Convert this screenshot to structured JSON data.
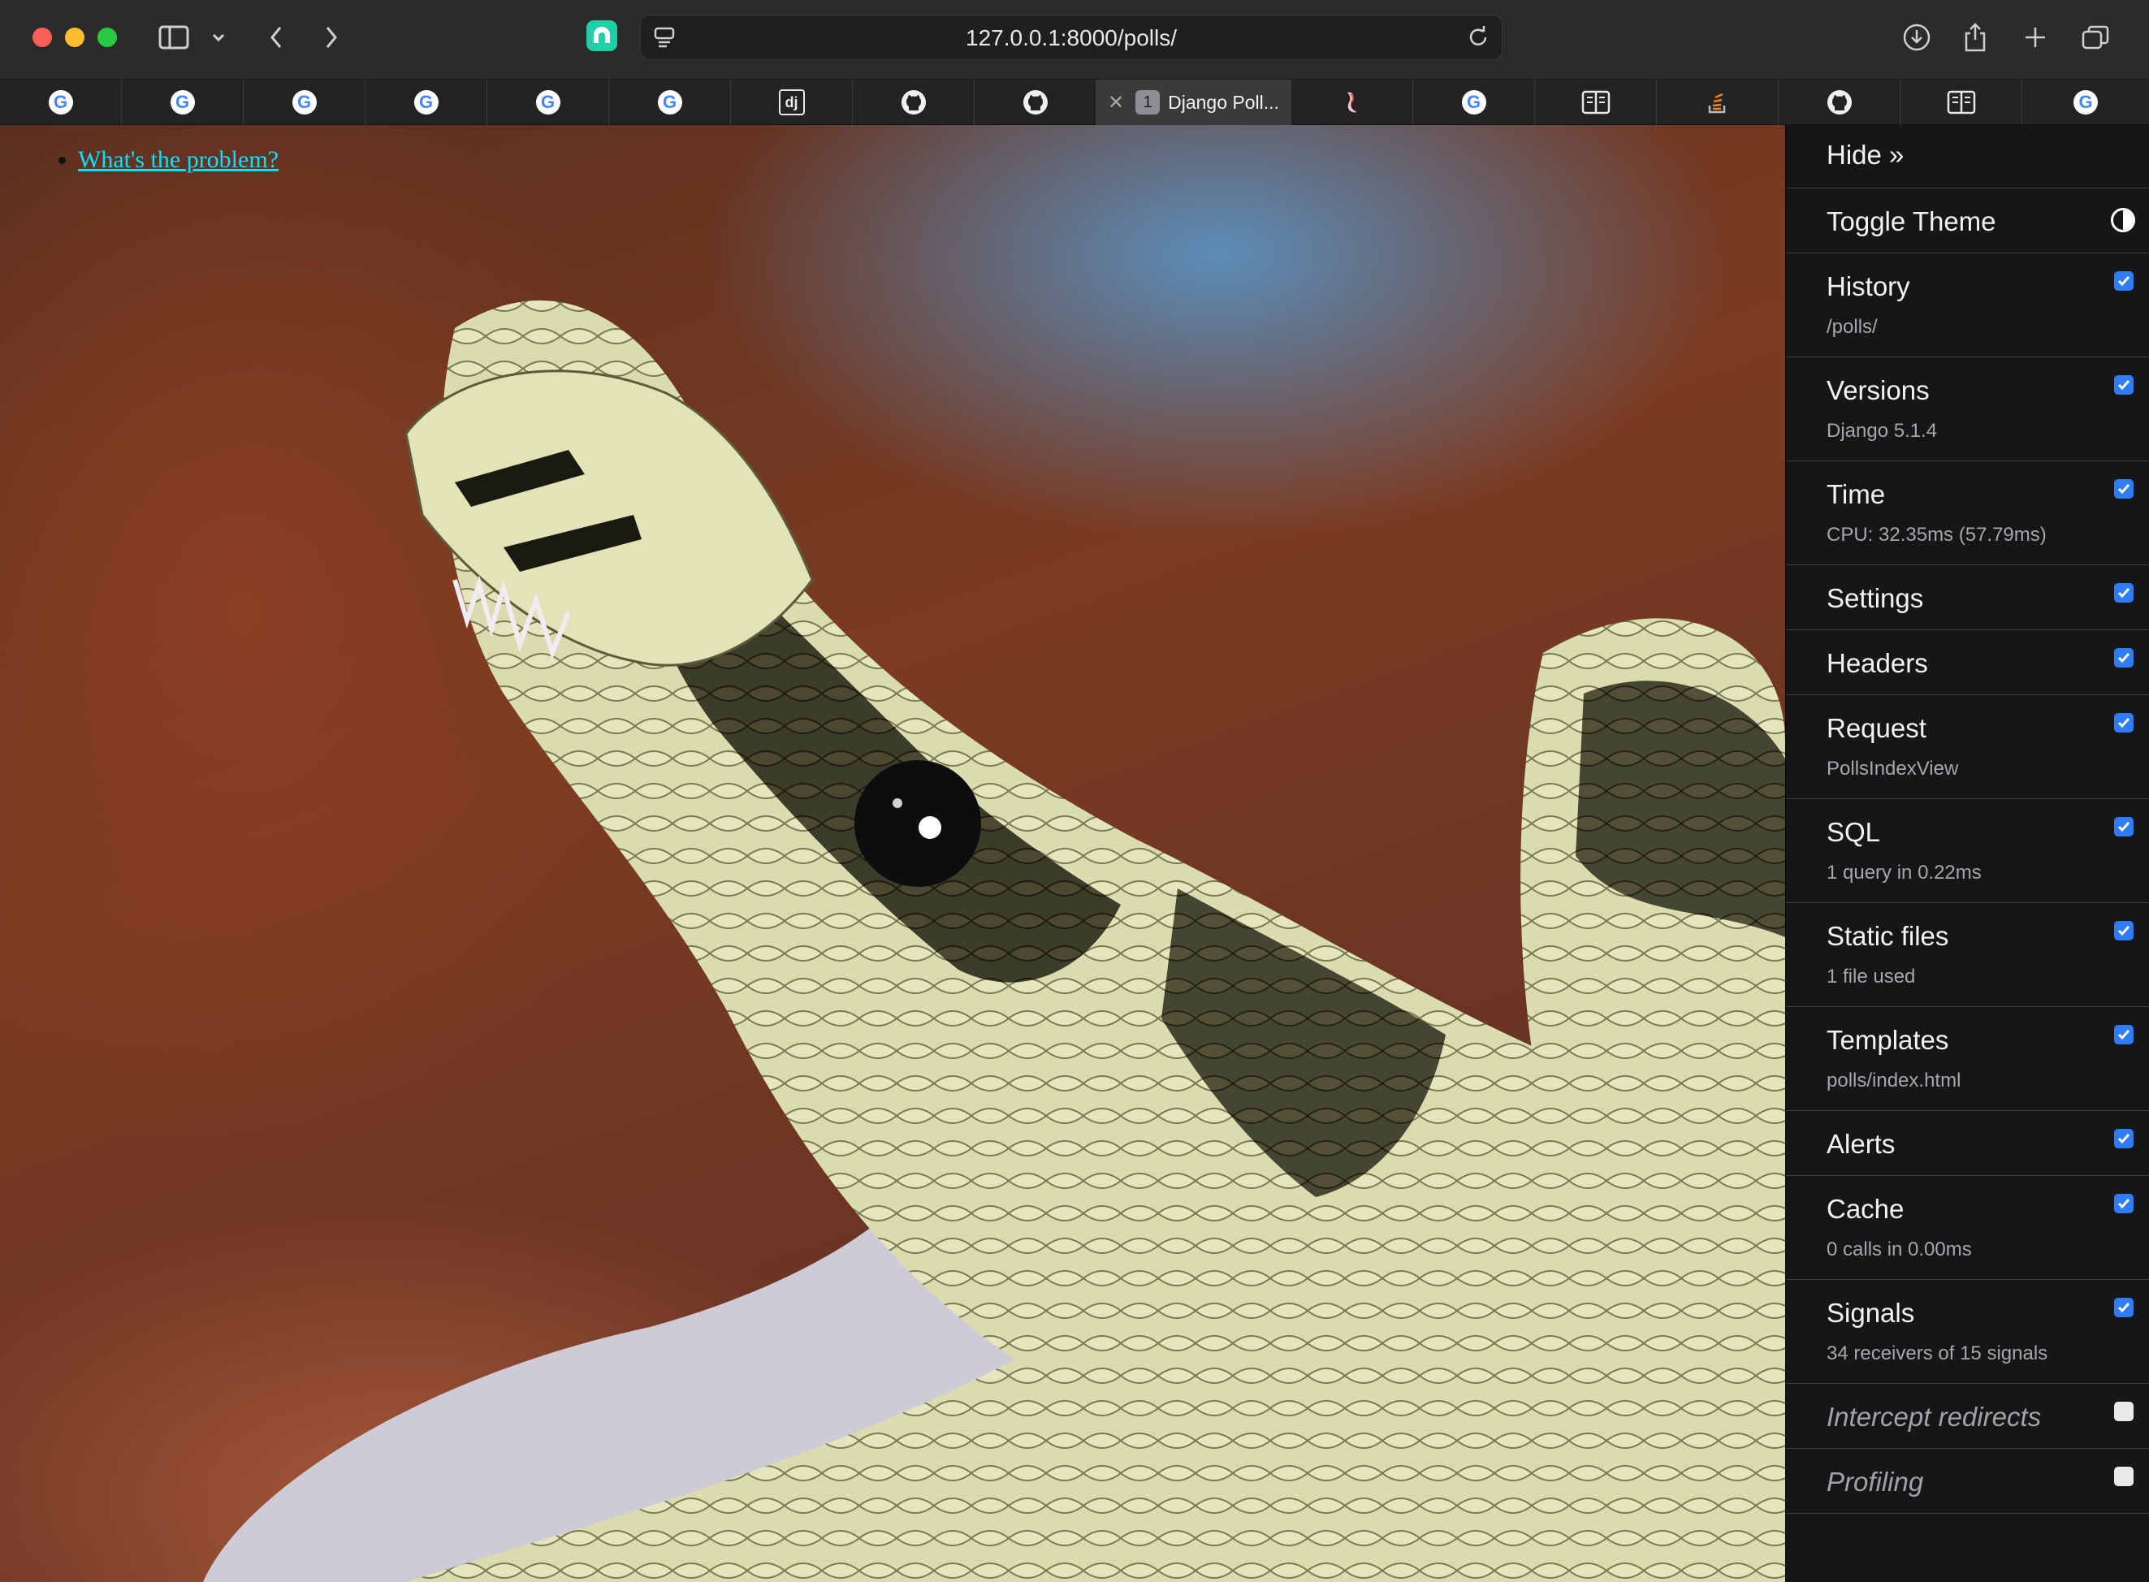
{
  "browser": {
    "url": "127.0.0.1:8000/polls/",
    "active_tab": {
      "badge": "1",
      "title": "Django Poll..."
    },
    "tabs": [
      {
        "icon": "google-icon"
      },
      {
        "icon": "google-icon"
      },
      {
        "icon": "google-icon"
      },
      {
        "icon": "google-icon"
      },
      {
        "icon": "google-icon"
      },
      {
        "icon": "google-icon"
      },
      {
        "icon": "django-icon",
        "label": "dj"
      },
      {
        "icon": "github-icon"
      },
      {
        "icon": "github-icon"
      },
      {
        "icon": "active"
      },
      {
        "icon": "app-icon"
      },
      {
        "icon": "google-icon"
      },
      {
        "icon": "reader-icon"
      },
      {
        "icon": "stackoverflow-icon"
      },
      {
        "icon": "github-icon"
      },
      {
        "icon": "reader-icon"
      },
      {
        "icon": "google-icon"
      }
    ],
    "google_glyph": "G"
  },
  "page": {
    "links": [
      "What's the problem?"
    ]
  },
  "toolbar": {
    "hide_label": "Hide »",
    "toggle_theme_label": "Toggle Theme",
    "panels": [
      {
        "title": "History",
        "sub": "/polls/",
        "checked": true
      },
      {
        "title": "Versions",
        "sub": "Django 5.1.4",
        "checked": true
      },
      {
        "title": "Time",
        "sub": "CPU: 32.35ms (57.79ms)",
        "checked": true
      },
      {
        "title": "Settings",
        "sub": "",
        "checked": true
      },
      {
        "title": "Headers",
        "sub": "",
        "checked": true
      },
      {
        "title": "Request",
        "sub": "PollsIndexView",
        "checked": true
      },
      {
        "title": "SQL",
        "sub": "1 query in 0.22ms",
        "checked": true
      },
      {
        "title": "Static files",
        "sub": "1 file used",
        "checked": true
      },
      {
        "title": "Templates",
        "sub": "polls/index.html",
        "checked": true
      },
      {
        "title": "Alerts",
        "sub": "",
        "checked": true
      },
      {
        "title": "Cache",
        "sub": "0 calls in 0.00ms",
        "checked": true
      },
      {
        "title": "Signals",
        "sub": "34 receivers of 15 signals",
        "checked": true
      },
      {
        "title": "Intercept redirects",
        "sub": "",
        "checked": false
      },
      {
        "title": "Profiling",
        "sub": "",
        "checked": false
      }
    ]
  },
  "colors": {
    "accent": "#2f7cf6",
    "link": "#00e5ff",
    "toolbar_bg": "#161618"
  }
}
